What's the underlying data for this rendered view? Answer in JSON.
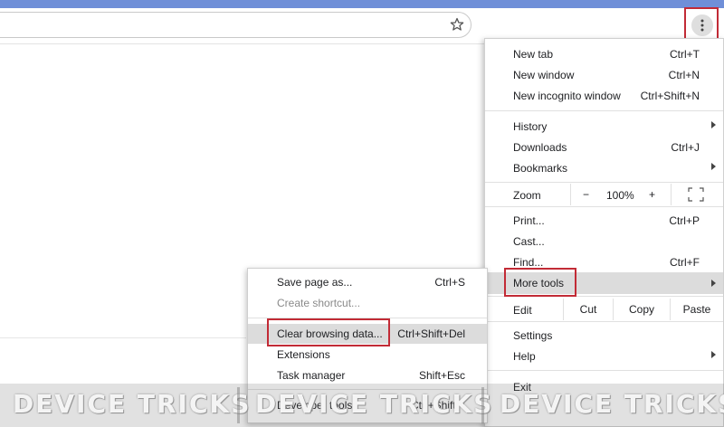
{
  "colors": {
    "accent_red": "#c22b36",
    "top_strip": "#6f8fd8",
    "highlight": "#dcdcdc"
  },
  "toolbar": {
    "star_icon": "star-icon",
    "menu_icon": "kebab-menu-icon"
  },
  "menu": {
    "items": [
      {
        "label": "New tab",
        "shortcut": "Ctrl+T"
      },
      {
        "label": "New window",
        "shortcut": "Ctrl+N"
      },
      {
        "label": "New incognito window",
        "shortcut": "Ctrl+Shift+N"
      },
      {
        "label": "History",
        "shortcut": ""
      },
      {
        "label": "Downloads",
        "shortcut": "Ctrl+J"
      },
      {
        "label": "Bookmarks",
        "shortcut": ""
      },
      {
        "label": "Print...",
        "shortcut": "Ctrl+P"
      },
      {
        "label": "Cast...",
        "shortcut": ""
      },
      {
        "label": "Find...",
        "shortcut": "Ctrl+F"
      },
      {
        "label": "More tools",
        "shortcut": ""
      },
      {
        "label": "Settings",
        "shortcut": ""
      },
      {
        "label": "Help",
        "shortcut": ""
      },
      {
        "label": "Exit",
        "shortcut": ""
      }
    ],
    "zoom": {
      "label": "Zoom",
      "minus": "−",
      "value": "100%",
      "plus": "+"
    },
    "edit": {
      "label": "Edit",
      "cut": "Cut",
      "copy": "Copy",
      "paste": "Paste"
    }
  },
  "submenu": {
    "items": [
      {
        "label": "Save page as...",
        "shortcut": "Ctrl+S"
      },
      {
        "label": "Create shortcut...",
        "shortcut": ""
      },
      {
        "label": "Clear browsing data...",
        "shortcut": "Ctrl+Shift+Del"
      },
      {
        "label": "Extensions",
        "shortcut": ""
      },
      {
        "label": "Task manager",
        "shortcut": "Shift+Esc"
      },
      {
        "label": "Developer tools",
        "shortcut": "Ctrl+Shift+I"
      }
    ]
  },
  "watermark": {
    "text": "DEVICE TRICKS"
  }
}
